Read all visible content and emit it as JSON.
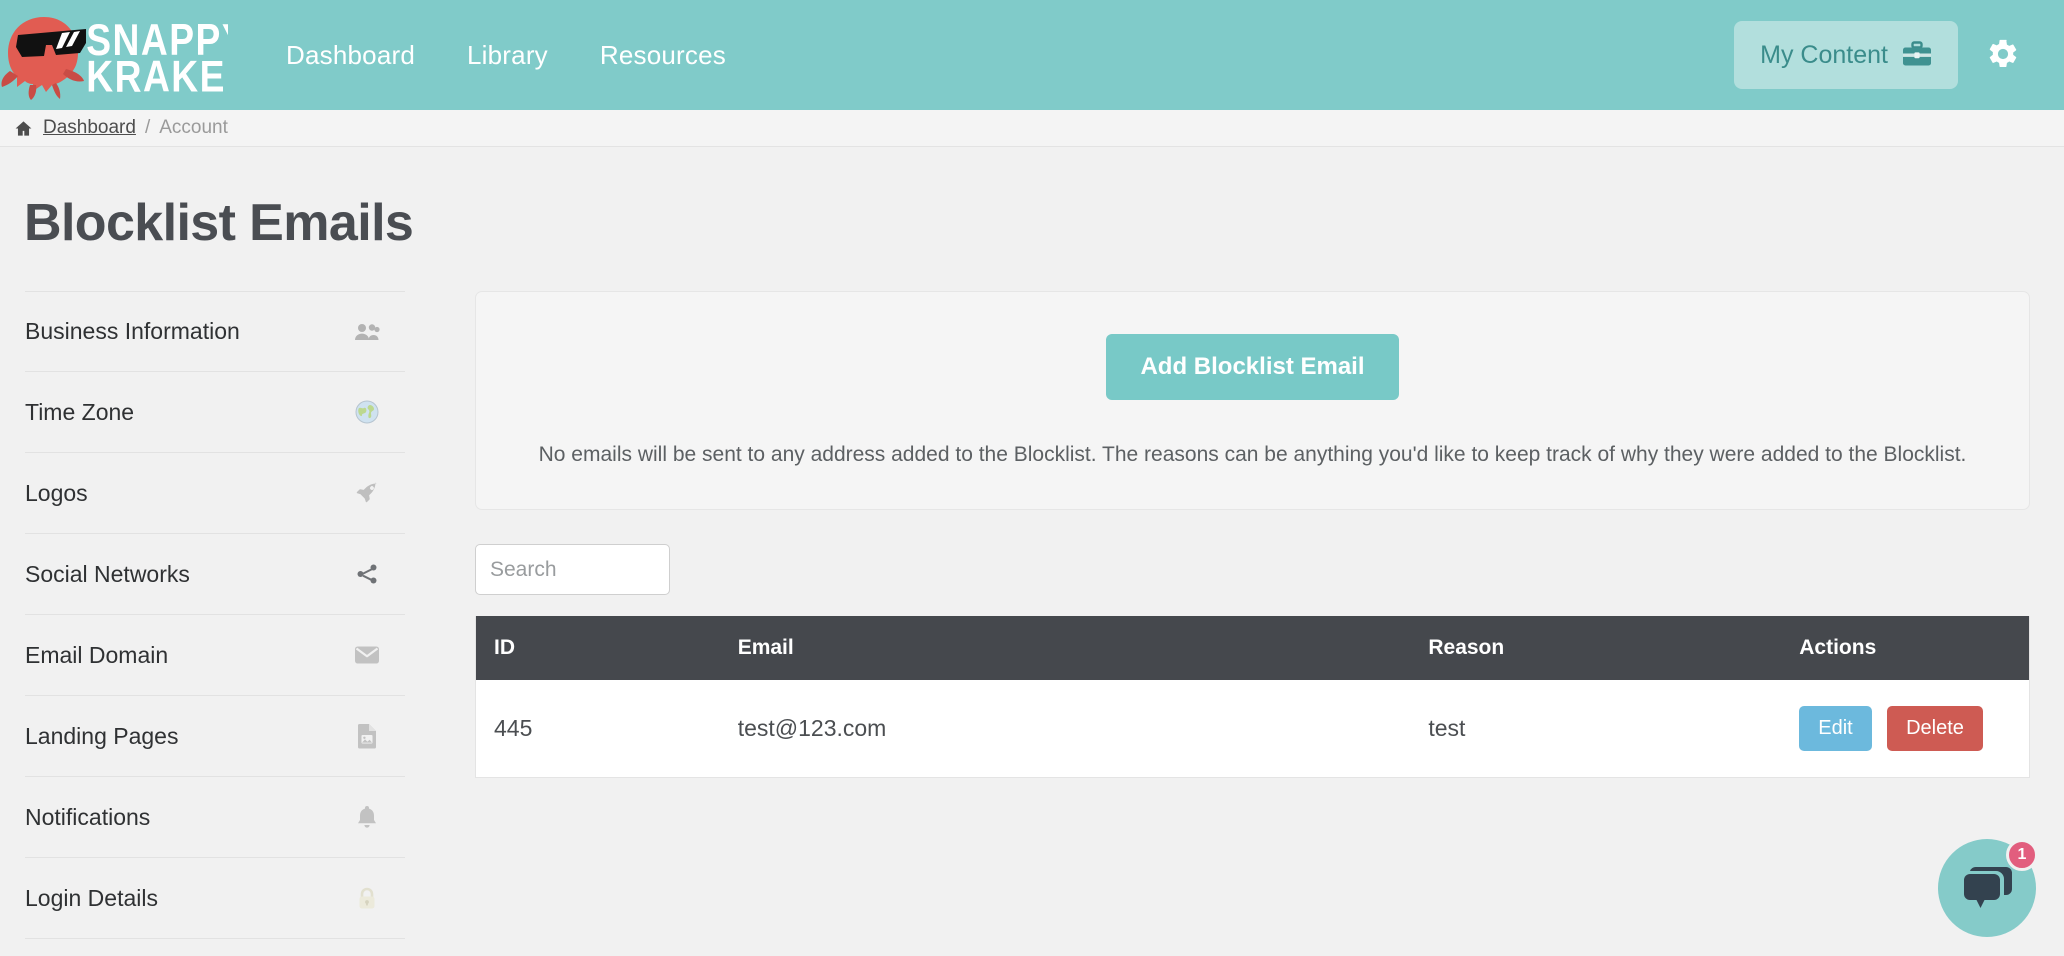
{
  "header": {
    "logo_name": "Snappy Kraken",
    "logo_line1": "SNAPPY",
    "logo_line2": "KRAKEN",
    "nav": [
      {
        "label": "Dashboard",
        "name": "nav-dashboard"
      },
      {
        "label": "Library",
        "name": "nav-library"
      },
      {
        "label": "Resources",
        "name": "nav-resources"
      }
    ],
    "my_content_label": "My Content",
    "my_content_icon": "briefcase-icon",
    "settings_icon": "gear-icon",
    "bg_color": "#80cbc9",
    "my_content_bg": "#b2dfdd",
    "my_content_text_color": "#3a8c8b"
  },
  "breadcrumb": {
    "home_icon": "home-icon",
    "link": "Dashboard",
    "separator": "/",
    "current": "Account"
  },
  "page": {
    "title": "Blocklist Emails"
  },
  "sidebar": {
    "items": [
      {
        "label": "Business Information",
        "icon": "users-icon"
      },
      {
        "label": "Time Zone",
        "icon": "globe-icon"
      },
      {
        "label": "Logos",
        "icon": "rocket-icon"
      },
      {
        "label": "Social Networks",
        "icon": "share-icon"
      },
      {
        "label": "Email Domain",
        "icon": "envelope-icon"
      },
      {
        "label": "Landing Pages",
        "icon": "image-file-icon"
      },
      {
        "label": "Notifications",
        "icon": "bell-icon"
      },
      {
        "label": "Login Details",
        "icon": "lock-icon"
      }
    ]
  },
  "main": {
    "add_button_label": "Add Blocklist Email",
    "add_button_color": "#78c9c7",
    "info_text": "No emails will be sent to any address added to the Blocklist. The reasons can be anything you'd like to keep track of why they were added to the Blocklist.",
    "search": {
      "value": "",
      "placeholder": "Search"
    },
    "table": {
      "columns": [
        "ID",
        "Email",
        "Reason",
        "Actions"
      ],
      "header_bg": "#45484d",
      "rows": [
        {
          "id": "445",
          "email": "test@123.com",
          "reason": "test",
          "edit_label": "Edit",
          "delete_label": "Delete",
          "edit_color": "#6cb9dd",
          "delete_color": "#ce5b53"
        }
      ]
    }
  },
  "chat": {
    "icon": "chat-bubble-icon",
    "badge_count": "1",
    "circle_color": "#85cbc9",
    "badge_color": "#e25e7e"
  }
}
